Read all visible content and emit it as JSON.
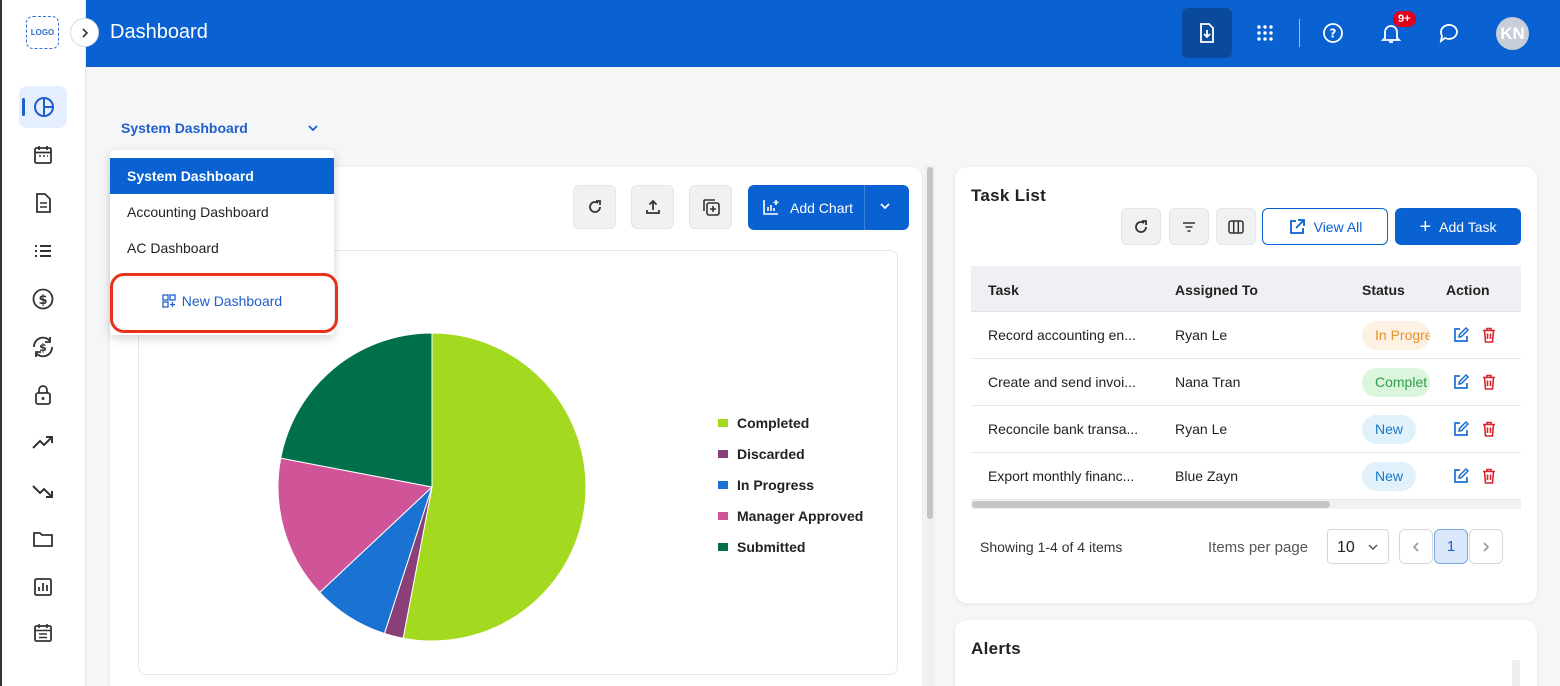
{
  "app": {
    "logo_text": "LOGO",
    "title": "Dashboard",
    "notification_count": "9+",
    "user_initials": "KN"
  },
  "sidebar": {
    "items": [
      {
        "name": "dashboard",
        "icon": "pie-chart-icon",
        "active": true
      },
      {
        "name": "calendar",
        "icon": "calendar-icon"
      },
      {
        "name": "documents",
        "icon": "document-icon"
      },
      {
        "name": "list",
        "icon": "list-icon"
      },
      {
        "name": "payments",
        "icon": "dollar-icon"
      },
      {
        "name": "exchange",
        "icon": "currency-exchange-icon"
      },
      {
        "name": "security",
        "icon": "lock-icon"
      },
      {
        "name": "income",
        "icon": "trending-up-icon"
      },
      {
        "name": "expenses",
        "icon": "trending-down-icon"
      },
      {
        "name": "files",
        "icon": "folder-icon"
      },
      {
        "name": "reports",
        "icon": "bar-report-icon"
      },
      {
        "name": "schedule",
        "icon": "calendar-list-icon"
      }
    ]
  },
  "dashboard_select": {
    "current": "System Dashboard",
    "options": [
      "System Dashboard",
      "Accounting Dashboard",
      "AC Dashboard"
    ],
    "new_label": "New Dashboard"
  },
  "chart_toolbar": {
    "add_chart_label": "Add Chart"
  },
  "chart_data": {
    "type": "pie",
    "categories": [
      "Completed",
      "Discarded",
      "In Progress",
      "Manager Approved",
      "Submitted"
    ],
    "values": [
      53,
      2,
      8,
      15,
      22
    ],
    "colors": [
      "#a3d91f",
      "#8a3f79",
      "#1a73d2",
      "#cf5498",
      "#006f4b"
    ],
    "legend_position": "right"
  },
  "task_list": {
    "title": "Task List",
    "view_all_label": "View All",
    "add_task_label": "Add Task",
    "columns": [
      "Task",
      "Assigned To",
      "Status",
      "Action"
    ],
    "rows": [
      {
        "task": "Record accounting en...",
        "assigned": "Ryan Le",
        "status": "In Progre",
        "status_color": "#e8912b",
        "status_bg": "#fdf1e3"
      },
      {
        "task": "Create and send invoi...",
        "assigned": "Nana Tran",
        "status": "Complet",
        "status_color": "#2e9f45",
        "status_bg": "#dcf6de"
      },
      {
        "task": "Reconcile bank transa...",
        "assigned": "Ryan Le",
        "status": "New",
        "status_color": "#1b78c8",
        "status_bg": "#e1f1fc"
      },
      {
        "task": "Export monthly financ...",
        "assigned": "Blue Zayn",
        "status": "New",
        "status_color": "#1b78c8",
        "status_bg": "#e1f1fc"
      }
    ],
    "pagination": {
      "info": "Showing 1-4 of 4 items",
      "items_per_page_label": "Items per page",
      "items_per_page": "10",
      "current_page": "1"
    }
  },
  "alerts": {
    "title": "Alerts"
  }
}
